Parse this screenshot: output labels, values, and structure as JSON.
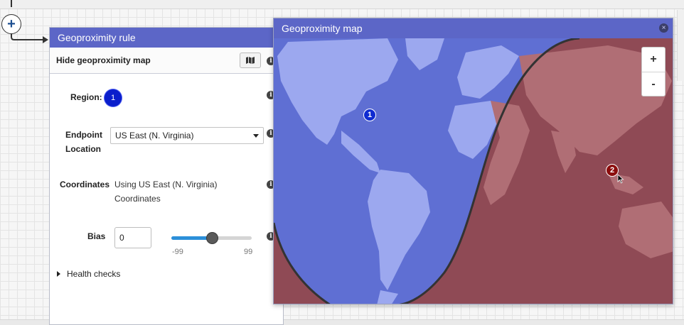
{
  "rule_panel": {
    "title": "Geoproximity rule",
    "hide_map_label": "Hide geoproximity map",
    "region_label": "Region:",
    "region_value": "1",
    "endpoint_label": "Endpoint\nLocation",
    "endpoint_value": "US East (N. Virginia)",
    "coordinates_label": "Coordinates",
    "coordinates_value": "Using US East (N. Virginia)\nCoordinates",
    "bias_label": "Bias",
    "bias_value": "0",
    "bias_slider": {
      "min": -99,
      "max": 99,
      "value": 0,
      "min_label": "-99",
      "max_label": "99"
    },
    "health_checks_label": "Health checks"
  },
  "map_window": {
    "title": "Geoproximity map",
    "zoom_in_label": "+",
    "zoom_out_label": "-",
    "markers": [
      {
        "label": "1",
        "color": "#0f2bd1"
      },
      {
        "label": "2",
        "color": "#8b0d0d"
      }
    ],
    "region_colors": {
      "region_1": "#6a78d8",
      "region_2": "#9b5d62"
    }
  },
  "colors": {
    "header": "#5c66c7",
    "accent": "#2c8fd9"
  },
  "icons": {
    "add": "plus-icon",
    "map_toggle": "map-icon",
    "info": "info-icon",
    "close": "close-icon"
  }
}
